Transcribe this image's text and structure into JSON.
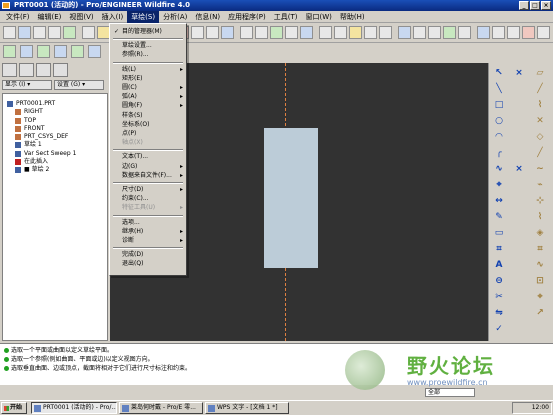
{
  "window": {
    "title": "PRT0001 (活动的) - Pro/ENGINEER Wildfire 4.0"
  },
  "menubar": {
    "items": [
      "文件(F)",
      "编辑(E)",
      "视图(V)",
      "插入(I)",
      "草绘(S)",
      "分析(A)",
      "信息(N)",
      "应用程序(P)",
      "工具(T)",
      "窗口(W)",
      "帮助(H)"
    ],
    "active_index": 4
  },
  "sketch_menu": {
    "items": [
      {
        "label": "目的管理器(M)",
        "checked": true
      },
      {
        "label": "草绘设置..."
      },
      {
        "label": "参照(R)..."
      },
      {
        "label": "线(L)",
        "sub": true
      },
      {
        "label": "矩形(E)"
      },
      {
        "label": "圆(C)",
        "sub": true
      },
      {
        "label": "弧(A)",
        "sub": true
      },
      {
        "label": "圆角(F)",
        "sub": true
      },
      {
        "label": "样条(S)"
      },
      {
        "label": "坐标系(O)"
      },
      {
        "label": "点(P)"
      },
      {
        "label": "轴点(X)",
        "disabled": true
      },
      {
        "label": "文本(T)..."
      },
      {
        "label": "边(G)",
        "sub": true
      },
      {
        "label": "数据来自文件(F)...",
        "sub": true
      },
      {
        "label": "尺寸(D)",
        "sub": true
      },
      {
        "label": "约束(C)..."
      },
      {
        "label": "特征工具(U)",
        "sub": true,
        "disabled": true
      },
      {
        "label": "选项..."
      },
      {
        "label": "继承(H)",
        "sub": true
      },
      {
        "label": "诊断",
        "sub": true
      },
      {
        "label": "完成(D)"
      },
      {
        "label": "退出(Q)"
      }
    ]
  },
  "nav": {
    "show_label": "显示 (I) ▾",
    "settings_label": "设置 (G) ▾"
  },
  "model_tree": {
    "items": [
      {
        "label": "PRT0001.PRT",
        "indent": 0,
        "color": "#4060a0"
      },
      {
        "label": "RIGHT",
        "indent": 1,
        "color": "#c07040"
      },
      {
        "label": "TOP",
        "indent": 1,
        "color": "#c07040"
      },
      {
        "label": "FRONT",
        "indent": 1,
        "color": "#c07040"
      },
      {
        "label": "PRT_CSYS_DEF",
        "indent": 1,
        "color": "#c07040"
      },
      {
        "label": "草绘 1",
        "indent": 1,
        "color": "#4060a0"
      },
      {
        "label": "Var Sect Sweep 1",
        "indent": 1,
        "color": "#4060a0"
      },
      {
        "label": "在此插入",
        "indent": 1,
        "color": "#c02020"
      },
      {
        "label": "■ 草绘 2",
        "indent": 1,
        "color": "#4060a0"
      }
    ]
  },
  "messages": [
    "选取一个平面或曲面以定义草绘平面。",
    "选取一个参照(例如曲面、平面或边)以定义视图方向。",
    "选取垂直曲面、边或顶点，截面将相对于它们进行尺寸标注和约束。"
  ],
  "watermark": {
    "text": "野火论坛",
    "url": "www.proewildfire.cn"
  },
  "status": {
    "filter": "全部"
  },
  "taskbar": {
    "start": "开始",
    "tasks": [
      "PRT0001 (活动的) - Pro/...",
      "莱岛何时戴 - Pro/E 零...",
      "WPS 文字 - [文档 1 *]"
    ],
    "active_task": 0,
    "time": "12:00"
  }
}
